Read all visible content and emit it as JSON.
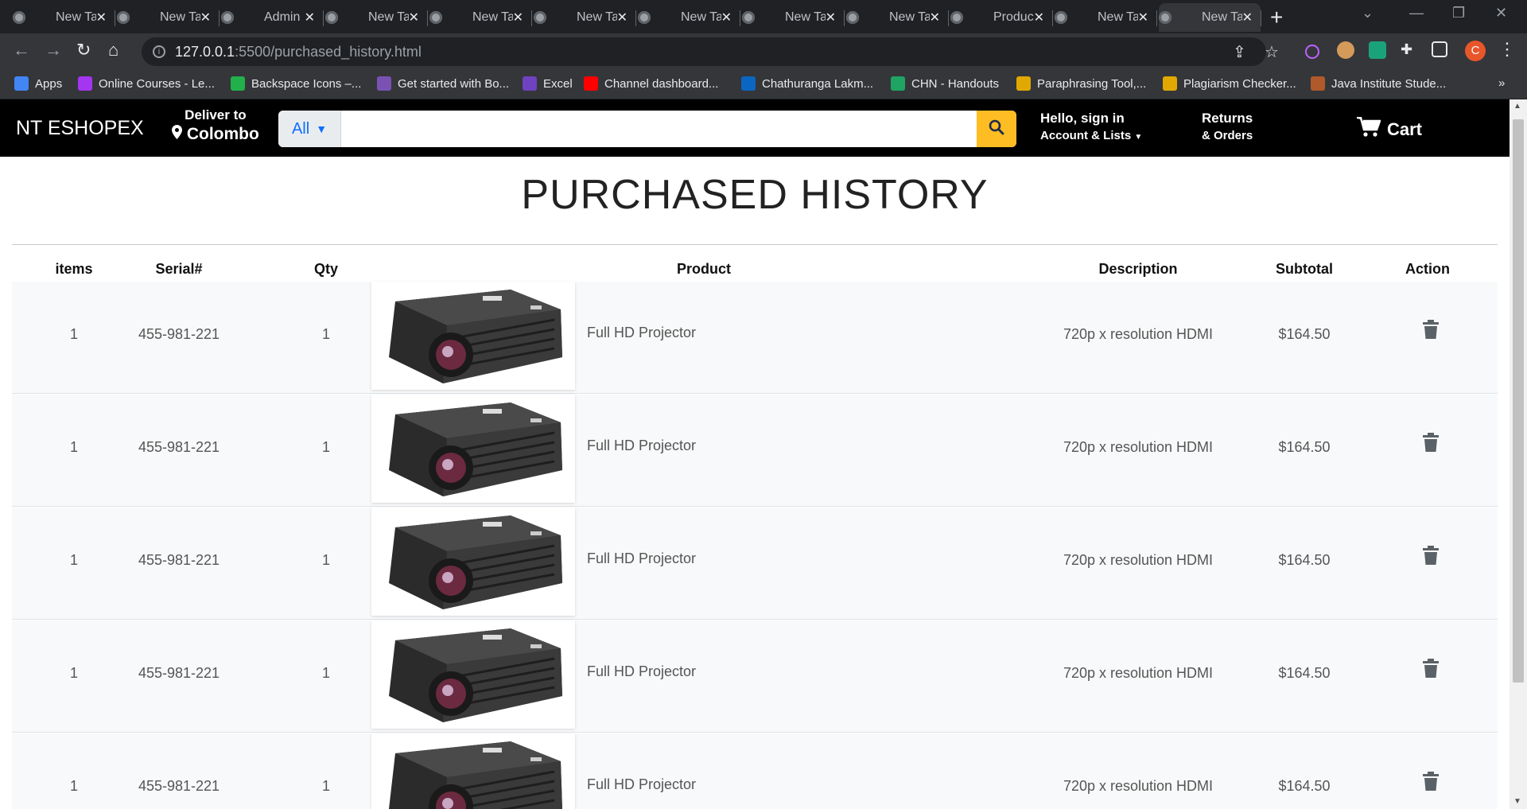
{
  "browser": {
    "tabs": [
      {
        "title": "New Tab"
      },
      {
        "title": "New Tab"
      },
      {
        "title": "Admin Panel"
      },
      {
        "title": "New Tab"
      },
      {
        "title": "New Tab"
      },
      {
        "title": "New Tab"
      },
      {
        "title": "New Tab"
      },
      {
        "title": "New Tab"
      },
      {
        "title": "New Tab"
      },
      {
        "title": "Product"
      },
      {
        "title": "New Tab"
      },
      {
        "title": "New Tab"
      }
    ],
    "url_host": "127.0.0.1",
    "url_path": ":5500/purchased_history.html",
    "profile_initial": "C",
    "bookmarks": [
      {
        "label": "Apps",
        "icon": "apps-grid-icon",
        "color": "#4285f4"
      },
      {
        "label": "Online Courses - Le...",
        "icon": "udemy-icon",
        "color": "#a435f0"
      },
      {
        "label": "Backspace Icons –...",
        "icon": "backspace-icon",
        "color": "#22b04b"
      },
      {
        "label": "Get started with Bo...",
        "icon": "bootstrap-icon",
        "color": "#7952b3"
      },
      {
        "label": "Excel",
        "icon": "excel-icon",
        "color": "#6f42c1"
      },
      {
        "label": "Channel dashboard...",
        "icon": "youtube-icon",
        "color": "#ff0000"
      },
      {
        "label": "Chathuranga Lakm...",
        "icon": "linkedin-icon",
        "color": "#0a66c2"
      },
      {
        "label": "CHN - Handouts",
        "icon": "google-drive-icon",
        "color": "#1fa463"
      },
      {
        "label": "Paraphrasing Tool,...",
        "icon": "magnifier-icon",
        "color": "#e0a800"
      },
      {
        "label": "Plagiarism Checker...",
        "icon": "magnifier-icon",
        "color": "#e0a800"
      },
      {
        "label": "Java Institute Stude...",
        "icon": "java-icon",
        "color": "#b05a2b"
      }
    ]
  },
  "nav": {
    "brand": "NT ESHOPEX",
    "deliver_line1": "Deliver to",
    "deliver_line2": "Colombo",
    "search_category": "All",
    "search_value": "",
    "signin_line1": "Hello, sign in",
    "signin_line2": "Account & Lists",
    "returns_line1": "Returns",
    "returns_line2": "& Orders",
    "cart_label": "Cart"
  },
  "page_title": "PURCHASED HISTORY",
  "table": {
    "headers": [
      "items",
      "Serial#",
      "Qty",
      "Product",
      "Description",
      "Subtotal",
      "Action"
    ],
    "rows": [
      {
        "item": "1",
        "serial": "455-981-221",
        "qty": "1",
        "product": "Full HD Projector",
        "description": "720p x resolution HDMI",
        "subtotal": "$164.50"
      },
      {
        "item": "1",
        "serial": "455-981-221",
        "qty": "1",
        "product": "Full HD Projector",
        "description": "720p x resolution HDMI",
        "subtotal": "$164.50"
      },
      {
        "item": "1",
        "serial": "455-981-221",
        "qty": "1",
        "product": "Full HD Projector",
        "description": "720p x resolution HDMI",
        "subtotal": "$164.50"
      },
      {
        "item": "1",
        "serial": "455-981-221",
        "qty": "1",
        "product": "Full HD Projector",
        "description": "720p x resolution HDMI",
        "subtotal": "$164.50"
      },
      {
        "item": "1",
        "serial": "455-981-221",
        "qty": "1",
        "product": "Full HD Projector",
        "description": "720p x resolution HDMI",
        "subtotal": "$164.50"
      }
    ]
  },
  "colors": {
    "nav_bg": "#000000",
    "search_button": "#febd23",
    "category_text": "#0d6efd",
    "chrome_dark": "#202124",
    "chrome_mid": "#35363a"
  }
}
